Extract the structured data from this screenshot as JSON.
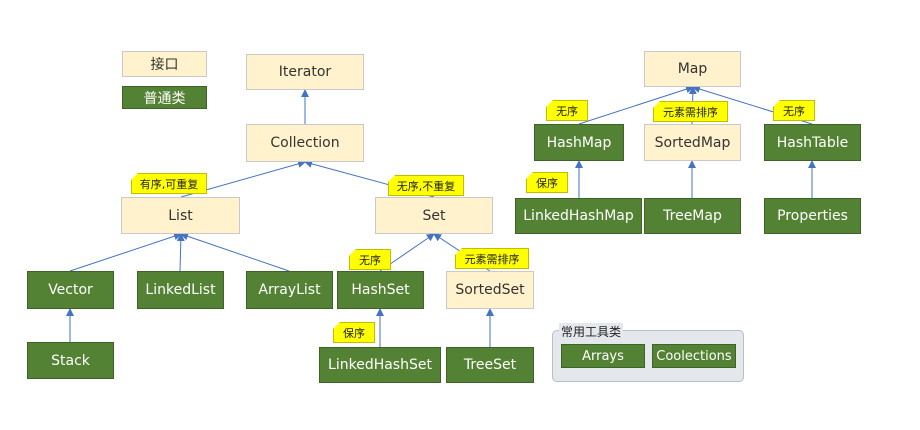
{
  "legend": {
    "interface": "接口",
    "class": "普通类"
  },
  "nodes": {
    "iterator": "Iterator",
    "collection": "Collection",
    "list": "List",
    "set": "Set",
    "vector": "Vector",
    "linkedlist": "LinkedList",
    "arraylist": "ArrayList",
    "hashset": "HashSet",
    "sortedset": "SortedSet",
    "stack": "Stack",
    "linkedhashset": "LinkedHashSet",
    "treeset": "TreeSet",
    "map": "Map",
    "hashmap": "HashMap",
    "sortedmap": "SortedMap",
    "hashtable": "HashTable",
    "linkedhashmap": "LinkedHashMap",
    "treemap": "TreeMap",
    "properties": "Properties"
  },
  "tags": {
    "list": "有序,可重复",
    "set": "无序,不重复",
    "hashset": "无序",
    "sortedset": "元素需排序",
    "linkedhashset": "保序",
    "hashmap": "无序",
    "sortedmap": "元素需排序",
    "hashtable": "无序",
    "linkedhashmap": "保序"
  },
  "tools": {
    "title": "常用工具类",
    "arrays": "Arrays",
    "collections": "Coolections"
  },
  "colors": {
    "interface": "#fff2cc",
    "class": "#548235",
    "tag": "#ffff00",
    "arrow": "#4472c4"
  }
}
